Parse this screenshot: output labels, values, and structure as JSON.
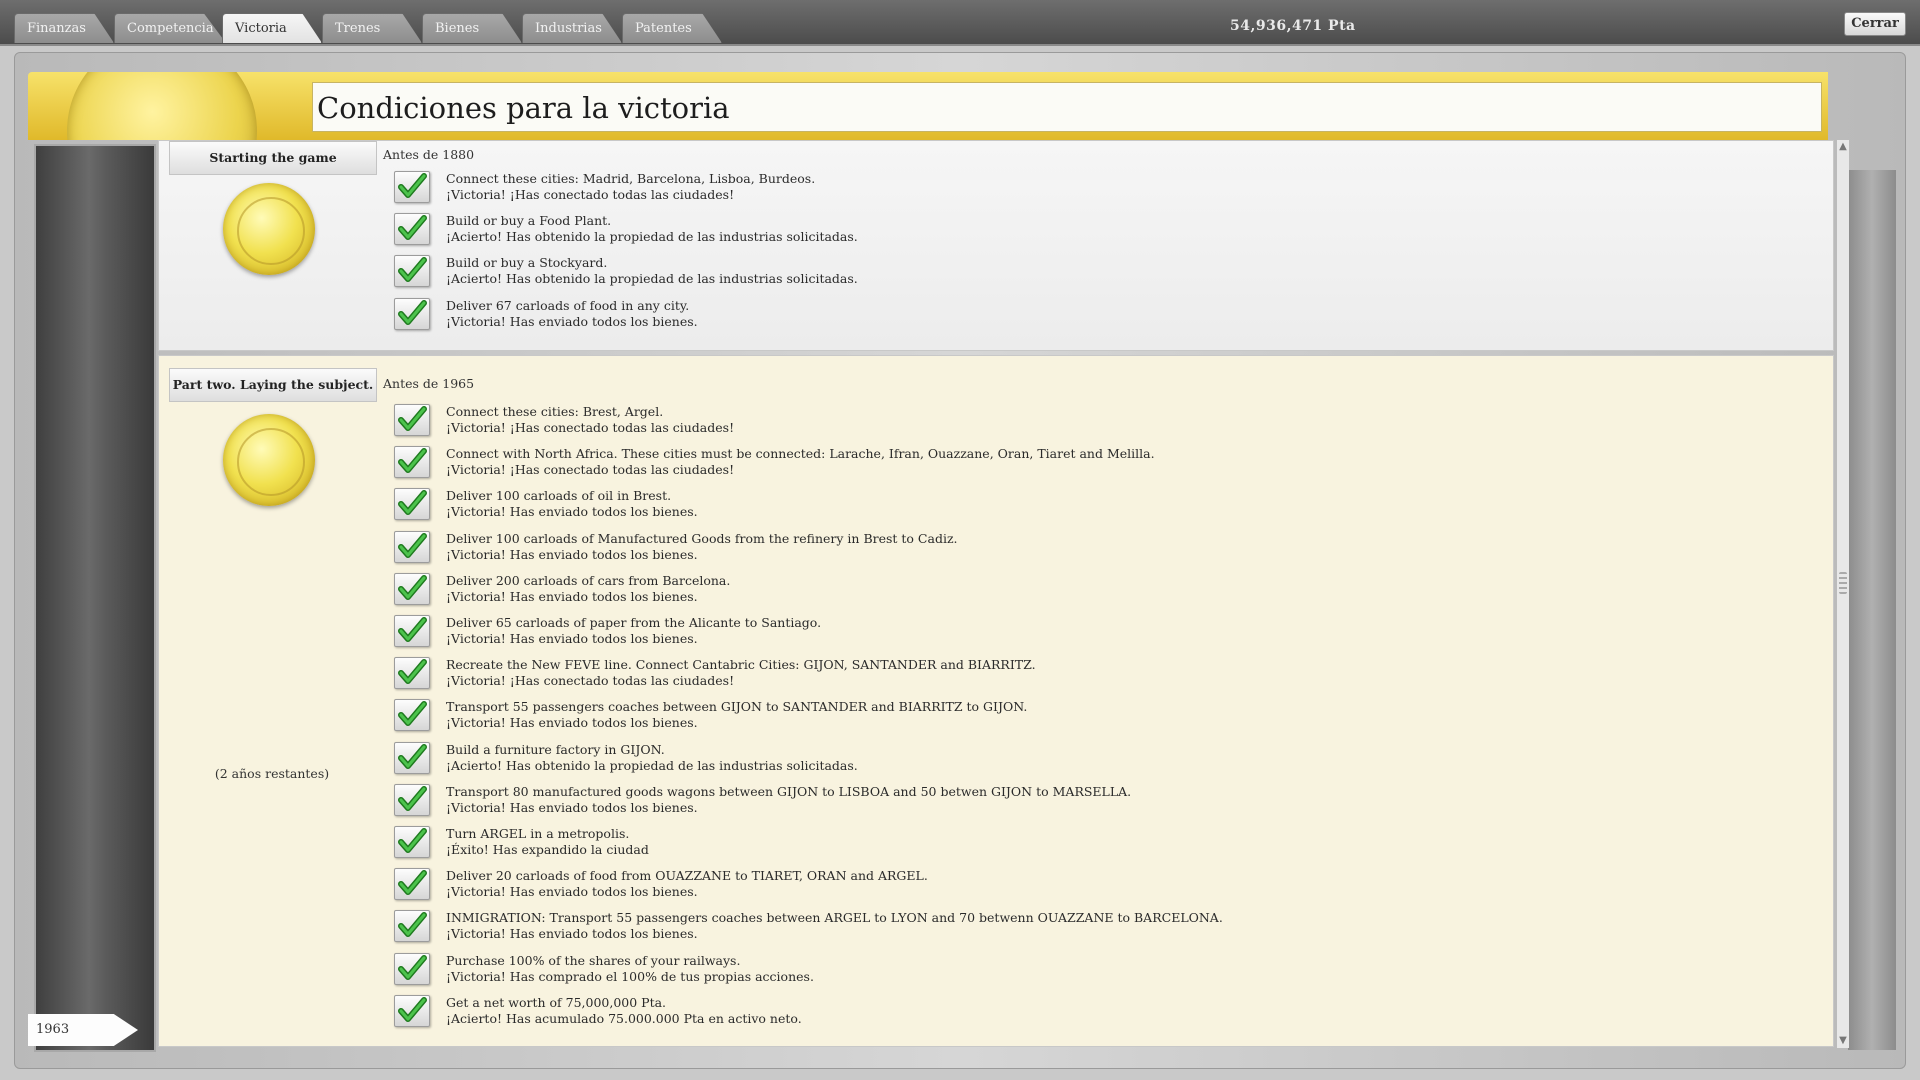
{
  "tabs": [
    {
      "label": "Finanzas",
      "active": false
    },
    {
      "label": "Competencia",
      "active": false
    },
    {
      "label": "Victoria",
      "active": true
    },
    {
      "label": "Trenes",
      "active": false
    },
    {
      "label": "Bienes",
      "active": false
    },
    {
      "label": "Industrias",
      "active": false
    },
    {
      "label": "Patentes",
      "active": false
    }
  ],
  "header": {
    "money": "54,936,471 Pta",
    "close_label": "Cerrar"
  },
  "page_title": "Condiciones para la victoria",
  "year": "1963",
  "sections": [
    {
      "label": "Starting the game",
      "deadline": "Antes de 1880",
      "remaining": "",
      "conditions": [
        {
          "goal": "Connect these cities: Madrid, Barcelona, Lisboa, Burdeos.",
          "status": "¡Victoria! ¡Has conectado todas las ciudades!"
        },
        {
          "goal": "Build or buy a Food Plant.",
          "status": "¡Acierto! Has obtenido la propiedad de las industrias solicitadas."
        },
        {
          "goal": "Build or buy a  Stockyard.",
          "status": "¡Acierto! Has obtenido la propiedad de las industrias solicitadas."
        },
        {
          "goal": "Deliver 67 carloads of food in any city.",
          "status": "¡Victoria! Has enviado todos los bienes."
        }
      ]
    },
    {
      "label": "Part two. Laying the subject.",
      "deadline": "Antes de 1965",
      "remaining": "(2 años restantes)",
      "conditions": [
        {
          "goal": "Connect these cities: Brest, Argel.",
          "status": "¡Victoria! ¡Has conectado todas las ciudades!"
        },
        {
          "goal": "Connect with North Africa. These cities must be connected: Larache, Ifran, Ouazzane, Oran, Tiaret and Melilla.",
          "status": "¡Victoria! ¡Has conectado todas las ciudades!"
        },
        {
          "goal": "Deliver 100 carloads of oil in Brest.",
          "status": "¡Victoria! Has enviado todos los bienes."
        },
        {
          "goal": "Deliver 100 carloads of Manufactured Goods from the refinery in Brest to Cadiz.",
          "status": "¡Victoria! Has enviado todos los bienes."
        },
        {
          "goal": "Deliver 200 carloads of cars from Barcelona.",
          "status": "¡Victoria! Has enviado todos los bienes."
        },
        {
          "goal": "Deliver 65 carloads of paper from the Alicante to Santiago.",
          "status": "¡Victoria! Has enviado todos los bienes."
        },
        {
          "goal": "Recreate the New FEVE line. Connect Cantabric Cities: GIJON, SANTANDER and BIARRITZ.",
          "status": "¡Victoria! ¡Has conectado todas las ciudades!"
        },
        {
          "goal": "Transport 55 passengers coaches between GIJON to SANTANDER and BIARRITZ to GIJON.",
          "status": "¡Victoria! Has enviado todos los bienes."
        },
        {
          "goal": "Build a furniture factory in GIJON.",
          "status": "¡Acierto! Has obtenido la propiedad de las industrias solicitadas."
        },
        {
          "goal": "Transport 80 manufactured goods wagons between GIJON to LISBOA and 50 betwen GIJON to MARSELLA.",
          "status": "¡Victoria! Has enviado todos los bienes."
        },
        {
          "goal": "Turn ARGEL in a metropolis.",
          "status": "¡Éxito! Has expandido la ciudad"
        },
        {
          "goal": "Deliver 20 carloads of food from OUAZZANE to TIARET, ORAN and ARGEL.",
          "status": "¡Victoria! Has enviado todos los bienes."
        },
        {
          "goal": "INMIGRATION: Transport 55 passengers coaches between ARGEL to LYON and 70 betwenn OUAZZANE to BARCELONA.",
          "status": "¡Victoria! Has enviado todos los bienes."
        },
        {
          "goal": "Purchase 100% of the shares of your railways.",
          "status": "¡Victoria! Has comprado el 100% de tus propias acciones."
        },
        {
          "goal": "Get a net worth of 75,000,000 Pta.",
          "status": "¡Acierto! Has acumulado 75.000.000 Pta en activo neto."
        }
      ]
    }
  ]
}
